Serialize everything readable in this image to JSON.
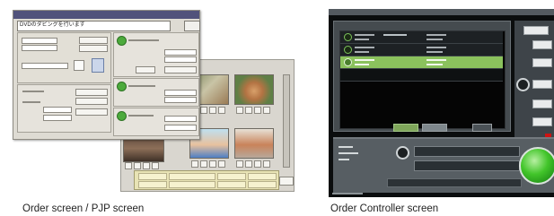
{
  "order_screen": {
    "input_text": "DVDのダビングを行います",
    "accent_button_color": "#4caa3c"
  },
  "controller_screen": {
    "go_button_color": "#42c52a",
    "selected_row_color": "#8bc25d",
    "stop_color": "#cf1212"
  },
  "captions": {
    "left": "Order screen / PJP screen",
    "right": "Order Controller screen"
  }
}
